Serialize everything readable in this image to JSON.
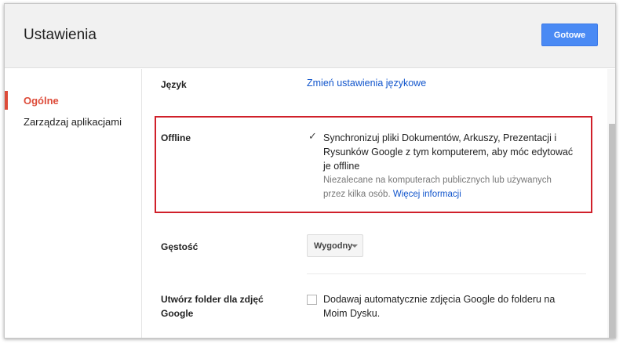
{
  "header": {
    "title": "Ustawienia",
    "done_label": "Gotowe"
  },
  "sidebar": {
    "items": [
      {
        "label": "Ogólne",
        "active": true
      },
      {
        "label": "Zarządzaj aplikacjami",
        "active": false
      }
    ]
  },
  "language": {
    "label": "Język",
    "link": "Zmień ustawienia językowe"
  },
  "offline": {
    "label": "Offline",
    "checked": true,
    "line1": "Synchronizuj pliki Dokumentów, Arkuszy, Prezentacji i",
    "line2": "Rysunków Google z tym komputerem, aby móc edytować",
    "line3": "je offline",
    "note_line1": "Niezalecane na komputerach publicznych lub używanych",
    "note_line2": "przez kilka osób.",
    "note_link": "Więcej informacji"
  },
  "density": {
    "label": "Gęstość",
    "selected": "Wygodny"
  },
  "photos": {
    "label_line1": "Utwórz folder dla zdjęć",
    "label_line2": "Google",
    "checked": false,
    "line1": "Dodawaj automatycznie zdjęcia Google do folderu na",
    "line2": "Moim Dysku."
  },
  "colors": {
    "accent_red": "#dd4b39",
    "button_blue": "#4a8af4",
    "link_blue": "#1155cc",
    "highlight_red": "#d0202a"
  }
}
